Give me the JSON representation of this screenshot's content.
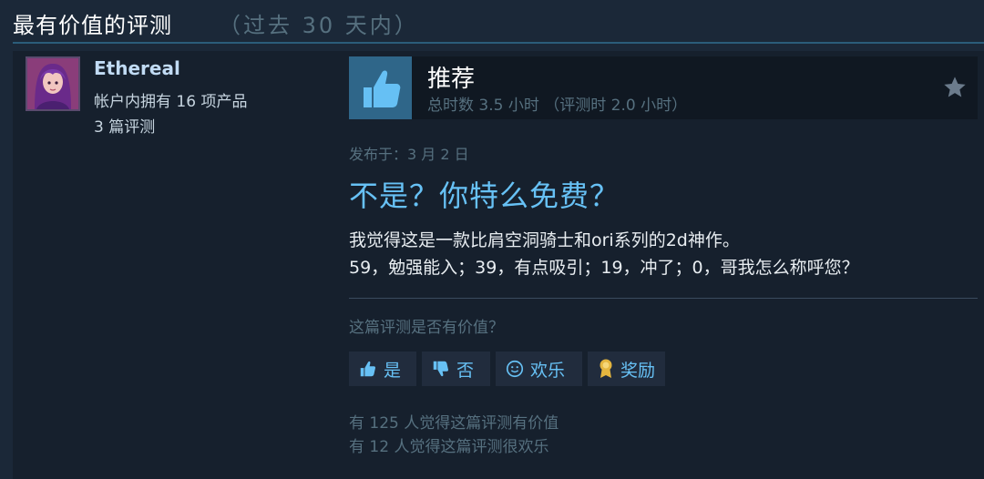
{
  "header": {
    "title": "最有价值的评测",
    "subtitle": "（过去 30 天内）"
  },
  "author": {
    "name": "Ethereal",
    "products_owned": "帐户内拥有 16 项产品",
    "review_count": "3 篇评测"
  },
  "recommendation": {
    "label": "推荐",
    "hours": "总时数 3.5 小时 （评测时 2.0 小时）"
  },
  "review": {
    "posted": "发布于：3 月 2 日",
    "title": "不是？你特么免费？",
    "body_line1": "我觉得这是一款比肩空洞骑士和ori系列的2d神作。",
    "body_line2": "59，勉强能入；39，有点吸引；19，冲了；0，哥我怎么称呼您？"
  },
  "feedback": {
    "question": "这篇评测是否有价值？",
    "yes_label": "是",
    "no_label": "否",
    "funny_label": "欢乐",
    "award_label": "奖励",
    "helpful_stat": "有 125 人觉得这篇评测有价值",
    "funny_stat": "有 12 人觉得这篇评测很欢乐"
  },
  "icons": {
    "thumb": "thumbs-up-icon",
    "star": "star-icon",
    "yes": "thumbs-up-icon",
    "no": "thumbs-down-icon",
    "funny": "smiley-icon",
    "award": "award-icon"
  },
  "colors": {
    "background": "#1b2838",
    "accent": "#67c1f5",
    "recommend_box": "#2f6689"
  }
}
